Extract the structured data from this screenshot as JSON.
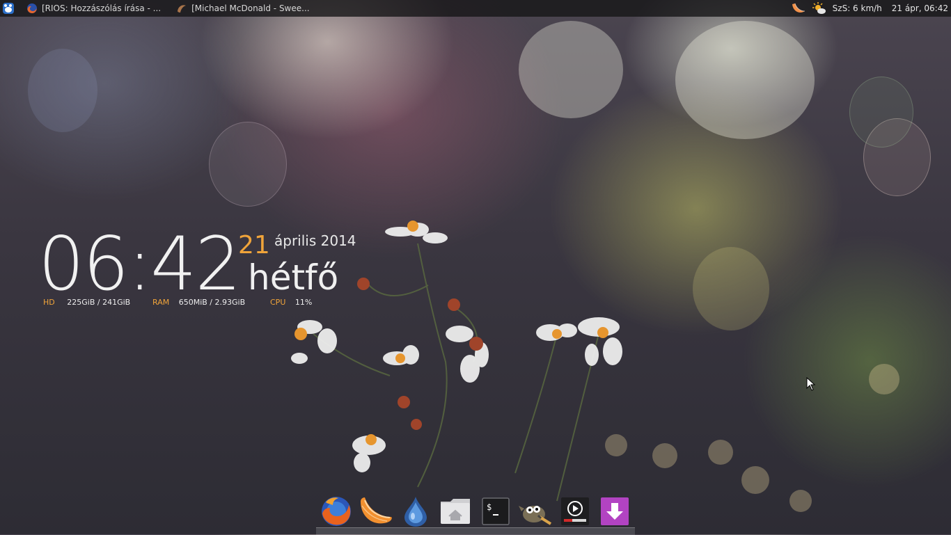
{
  "top_panel": {
    "tasks": [
      {
        "title": "[RIOS: Hozzászólás írása - ...",
        "icon": "firefox-icon"
      },
      {
        "title": "[Michael McDonald - Swee...",
        "icon": "clementine-icon"
      }
    ],
    "tray": {
      "weather": "SzS: 6 km/h",
      "clock": "21 ápr, 06:42"
    }
  },
  "conky": {
    "time": "06:42",
    "day": "21",
    "month_year": "április 2014",
    "weekday": "hétfő",
    "hd_label": "HD",
    "hd_value": "225GiB  / 241GiB",
    "ram_label": "RAM",
    "ram_value": "650MiB  / 2.93GiB",
    "cpu_label": "CPU",
    "cpu_value": "11%"
  },
  "dock": {
    "items": [
      "firefox",
      "clementine",
      "deluge",
      "home-folder",
      "terminal",
      "gimp",
      "media-player",
      "downloader"
    ]
  },
  "colors": {
    "accent": "#f0a43a",
    "panel_bg": "#1a1a1c"
  }
}
